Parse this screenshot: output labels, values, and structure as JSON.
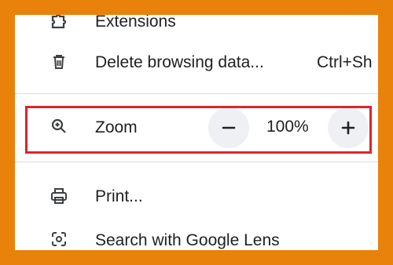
{
  "menu": {
    "extensions": {
      "label": "Extensions",
      "icon": "puzzle-icon"
    },
    "delete_browsing_data": {
      "label": "Delete browsing data...",
      "shortcut": "Ctrl+Sh",
      "icon": "trash-icon"
    },
    "zoom": {
      "label": "Zoom",
      "icon": "zoom-in-icon",
      "value": "100%",
      "minus_icon": "minus-icon",
      "plus_icon": "plus-icon"
    },
    "print": {
      "label": "Print...",
      "icon": "printer-icon"
    },
    "google_lens": {
      "label": "Search with Google Lens",
      "icon": "google-lens-icon"
    }
  },
  "colors": {
    "frame_border": "#e8820a",
    "highlight_border": "#d9262b",
    "zoom_button_bg": "#eef0f3",
    "text": "#202124"
  }
}
